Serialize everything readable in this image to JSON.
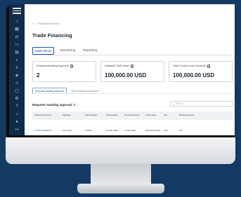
{
  "app": {
    "breadcrumb": {
      "home": "⌂",
      "current": "Financial Services"
    },
    "title": "Trade Financing",
    "tabs": [
      {
        "label": "Applications",
        "active": true
      },
      {
        "label": "Monitoring",
        "active": false
      },
      {
        "label": "Reporting",
        "active": false
      }
    ],
    "cards": [
      {
        "label": "Requests Awaiting Approval",
        "value": "2"
      },
      {
        "label": "Available OMR Value",
        "value": "100,000.00 USD"
      },
      {
        "label": "Total Current Loan Exposure",
        "value": "100,000.00 USD"
      }
    ],
    "subtabs": [
      {
        "label": "Requests Awaiting Approval",
        "active": true
      },
      {
        "label": "Offers Awaiting Acceptance",
        "active": false
      }
    ],
    "section_title": "Requests Awaiting Approval: 2",
    "search": {
      "placeholder": "Search"
    },
    "table": {
      "headers": [
        "Trade Contract No.",
        "Applicant",
        "Date Initiated",
        "Date Applied",
        "Goods Received",
        "Trade Value",
        "LTV",
        "Monthly Interest"
      ],
      "rows": [
        [
          "TC0001-00000000",
          "Sun Trade",
          "10/3/24",
          "02 Sep 2022",
          "27 Sep 2022",
          "100,000.00 USD",
          "10%",
          "1%"
        ]
      ]
    }
  },
  "colors": {
    "background": "#123a63",
    "sidebar": "#0f2c4c",
    "accent": "#1a5aa0"
  },
  "sidebar_icons": [
    "home-icon",
    "dashboard-icon",
    "transfer-icon",
    "cards-icon",
    "chart-icon",
    "search-icon",
    "list-icon",
    "trade-icon",
    "people-icon",
    "document-icon",
    "settings-icon",
    "help-icon",
    "bell-icon",
    "user-icon",
    "logout-icon"
  ]
}
